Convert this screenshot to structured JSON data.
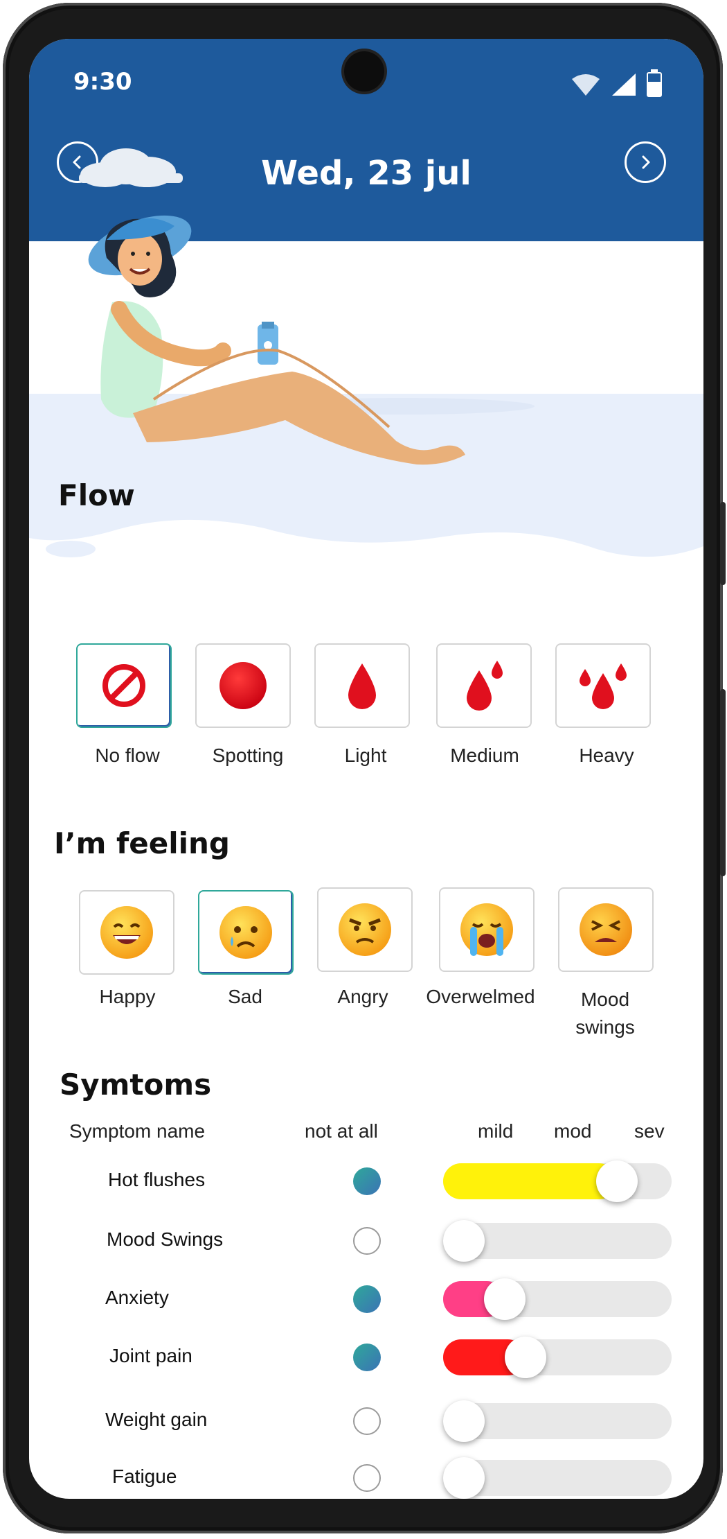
{
  "status_bar": {
    "time": "9:30"
  },
  "header": {
    "date": "Wed, 23 jul",
    "prev_icon": "chevron-left-icon",
    "next_icon": "chevron-right-icon"
  },
  "colors": {
    "header_bg": "#1e5a9c",
    "blood_red": "#e0101e",
    "selected_border": "#2fa89a"
  },
  "flow": {
    "title": "Flow",
    "options": [
      {
        "label": "No flow",
        "icon": "prohibited-icon",
        "selected": true
      },
      {
        "label": "Spotting",
        "icon": "red-circle-icon",
        "selected": false
      },
      {
        "label": "Light",
        "icon": "single-drop-icon",
        "selected": false
      },
      {
        "label": "Medium",
        "icon": "two-drops-icon",
        "selected": false
      },
      {
        "label": "Heavy",
        "icon": "three-drops-icon",
        "selected": false
      }
    ]
  },
  "feeling": {
    "title": "I’m feeling",
    "options": [
      {
        "label": "Happy",
        "icon": "happy-emoji-icon",
        "selected": false
      },
      {
        "label": "Sad",
        "icon": "sad-emoji-icon",
        "selected": true
      },
      {
        "label": "Angry",
        "icon": "angry-emoji-icon",
        "selected": false
      },
      {
        "label": "Overwelmed",
        "icon": "crying-emoji-icon",
        "selected": false
      },
      {
        "label": "Mood swings",
        "label_line1": "Mood",
        "label_line2": "swings",
        "icon": "tired-emoji-icon",
        "selected": false
      }
    ]
  },
  "symptoms": {
    "title": "Symtoms",
    "col_name": "Symptom name",
    "col_none": "not at all",
    "col_mild": "mild",
    "col_mod": "mod",
    "col_sev": "sev",
    "rows": [
      {
        "name": "Hot flushes",
        "active": true,
        "level": 0.82,
        "color": "#fff20a"
      },
      {
        "name": "Mood Swings",
        "active": false,
        "level": 0.0,
        "color": "#e8e8e8"
      },
      {
        "name": "Anxiety",
        "active": true,
        "level": 0.22,
        "color": "#ff3f86"
      },
      {
        "name": "Joint pain",
        "active": true,
        "level": 0.33,
        "color": "#ff1a1a"
      },
      {
        "name": "Weight gain",
        "active": false,
        "level": 0.0,
        "color": "#e8e8e8"
      },
      {
        "name": "Fatigue",
        "active": false,
        "level": 0.0,
        "color": "#e8e8e8"
      }
    ]
  }
}
